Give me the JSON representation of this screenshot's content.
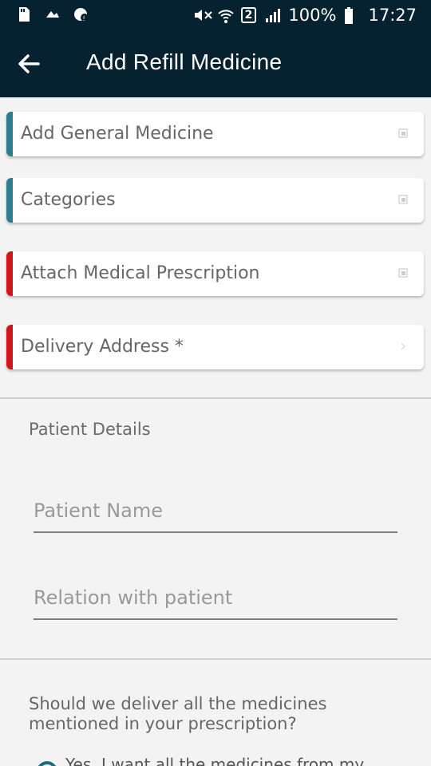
{
  "status_bar": {
    "battery": "100%",
    "time": "17:27",
    "sim_slot": "2"
  },
  "header": {
    "title": "Add Refill Medicine"
  },
  "cards": [
    {
      "label": "Add General Medicine",
      "accent": "#2e7d8c",
      "icon": "open-icon"
    },
    {
      "label": "Categories",
      "accent": "#2e7d8c",
      "icon": "open-icon"
    },
    {
      "label": "Attach Medical Prescription",
      "accent": "#d0141e",
      "icon": "open-icon"
    },
    {
      "label": "Delivery Address *",
      "accent": "#d0141e",
      "icon": "chevron-right-icon"
    }
  ],
  "patient": {
    "section_title": "Patient Details",
    "name_placeholder": "Patient Name",
    "relation_placeholder": "Relation with patient"
  },
  "delivery": {
    "question": "Should we deliver all the medicines mentioned in your prescription?",
    "option_yes": "Yes, I want all the medicines from my"
  },
  "colors": {
    "header_bg": "#062130",
    "page_bg": "#f3f3f3"
  }
}
